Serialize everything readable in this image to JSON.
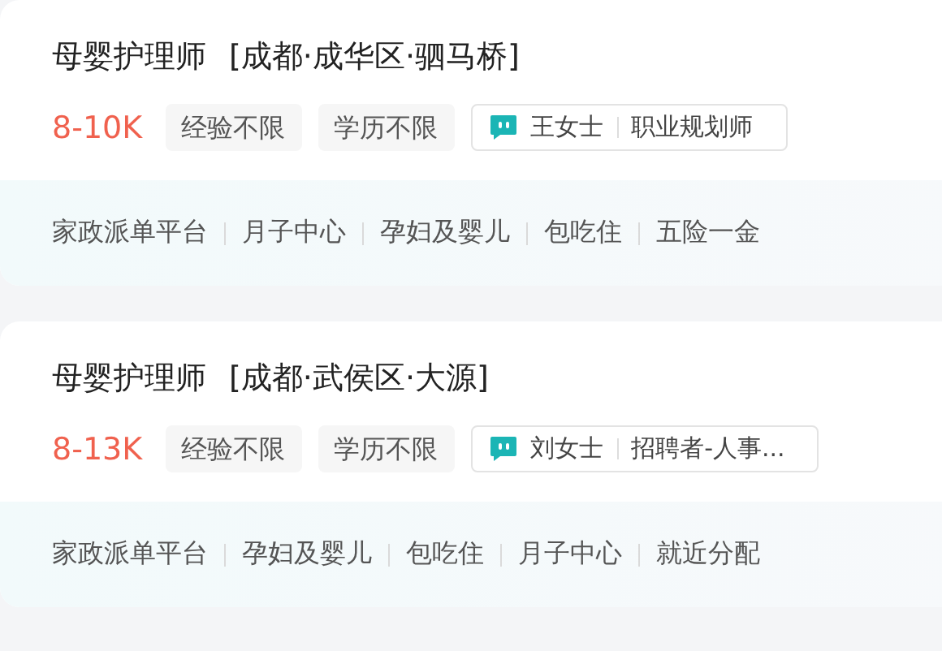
{
  "jobs": [
    {
      "title": "母婴护理师",
      "location": "[成都·成华区·驷马桥]",
      "salary": "8-10K",
      "tags": [
        "经验不限",
        "学历不限"
      ],
      "recruiter": {
        "name": "王女士",
        "role": "职业规划师"
      },
      "welfare": [
        "家政派单平台",
        "月子中心",
        "孕妇及婴儿",
        "包吃住",
        "五险一金"
      ]
    },
    {
      "title": "母婴护理师",
      "location": "[成都·武侯区·大源]",
      "salary": "8-13K",
      "tags": [
        "经验不限",
        "学历不限"
      ],
      "recruiter": {
        "name": "刘女士",
        "role": "招聘者-人事..."
      },
      "welfare": [
        "家政派单平台",
        "孕妇及婴儿",
        "包吃住",
        "月子中心",
        "就近分配"
      ]
    }
  ]
}
